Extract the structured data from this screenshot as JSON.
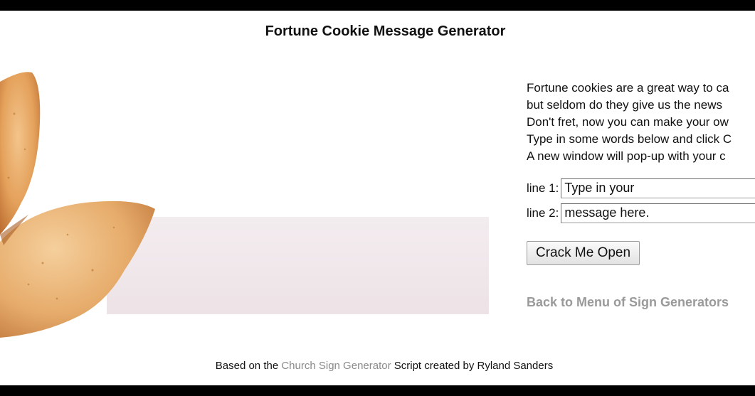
{
  "page": {
    "title": "Fortune Cookie Message Generator"
  },
  "intro": {
    "lines": [
      "Fortune cookies are a great way to ca",
      "but seldom do they give us the news",
      "Don't fret, now you can make your ow",
      "Type in some words below and click C",
      "A new window will pop-up with your c"
    ]
  },
  "form": {
    "line1_label": "line 1:",
    "line1_value": "Type in your",
    "line2_label": "line 2:",
    "line2_value": "message here.",
    "submit_label": "Crack Me Open"
  },
  "nav": {
    "back_link": "Back to Menu of Sign Generators"
  },
  "footer": {
    "prefix": "Based on the ",
    "link_text": "Church Sign Generator",
    "suffix": " Script created by Ryland Sanders"
  },
  "colors": {
    "cookie": "#e8a963",
    "paper_slip": "#f1e8ec",
    "link_gray": "#9a9a9a"
  },
  "icons": {
    "cookie_image": "fortune-cookie-icon"
  }
}
